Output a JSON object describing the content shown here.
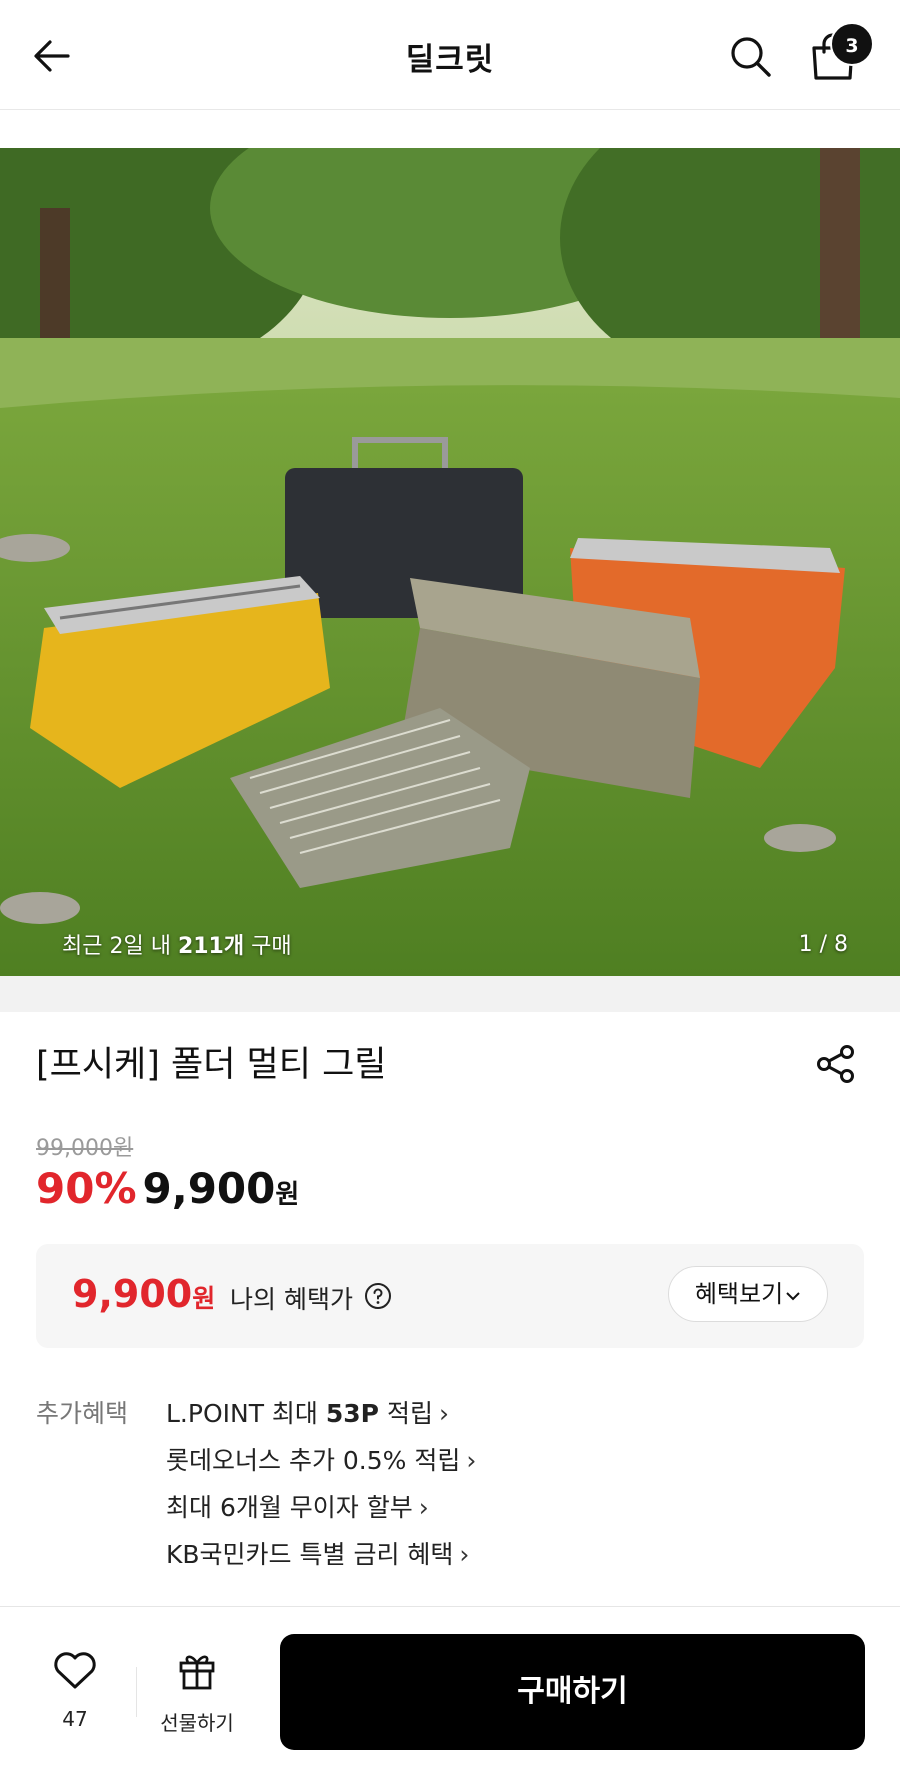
{
  "header": {
    "title": "딜크릿",
    "cart_count": "3"
  },
  "hero": {
    "purchase_prefix": "최근 2일 내 ",
    "purchase_count": "211개",
    "purchase_suffix": " 구매",
    "page_indicator": "1 / 8"
  },
  "product": {
    "title": "[프시케] 폴더 멀티 그릴",
    "original_price": "99,000원",
    "discount": "90%",
    "sale_price": "9,900",
    "currency": "원"
  },
  "benefit": {
    "price": "9,900",
    "currency": "원",
    "label": "나의 혜택가",
    "button_label": "혜택보기"
  },
  "extra": {
    "label": "추가혜택",
    "items": [
      {
        "pre": "L.POINT 최대 ",
        "bold": "53P",
        "post": " 적립"
      },
      {
        "pre": "롯데오너스 추가 0.5% 적립",
        "bold": "",
        "post": ""
      },
      {
        "pre": "최대 6개월 무이자 할부",
        "bold": "",
        "post": ""
      },
      {
        "pre": "KB국민카드 특별 금리 혜택",
        "bold": "",
        "post": ""
      }
    ]
  },
  "bottom": {
    "like_count": "47",
    "gift_label": "선물하기",
    "buy_label": "구매하기"
  },
  "colors": {
    "accent_red": "#e1262c",
    "buy_button": "#000000"
  },
  "icons": [
    "back-arrow-icon",
    "search-icon",
    "shopping-bag-icon",
    "share-icon",
    "question-circle-icon",
    "chevron-down-icon",
    "chevron-right-icon",
    "heart-icon",
    "gift-icon"
  ]
}
